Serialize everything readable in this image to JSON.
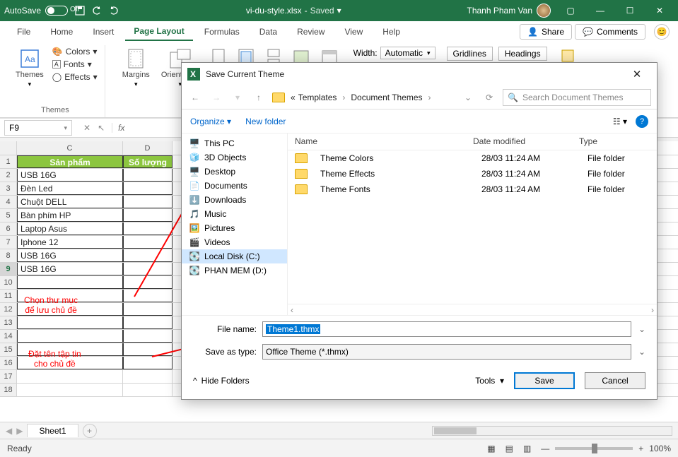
{
  "titlebar": {
    "autosave_label": "AutoSave",
    "toggle_off": "Off",
    "filename": "vi-du-style.xlsx",
    "saved": "Saved",
    "user": "Thanh Pham Van"
  },
  "tabs": [
    "File",
    "Home",
    "Insert",
    "Page Layout",
    "Formulas",
    "Data",
    "Review",
    "View",
    "Help"
  ],
  "active_tab": "Page Layout",
  "share": "Share",
  "comments": "Comments",
  "ribbon": {
    "themes_group": "Themes",
    "themes": "Themes",
    "colors": "Colors",
    "fonts": "Fonts",
    "effects": "Effects",
    "margins": "Margins",
    "orientation": "Orientation",
    "width": "Width:",
    "width_val": "Automatic",
    "gridlines": "Gridlines",
    "headings": "Headings"
  },
  "namebox": "F9",
  "columns": [
    "C",
    "D"
  ],
  "header_row": {
    "c": "Sản phẩm",
    "d": "Số lượng"
  },
  "rows": [
    "USB 16G",
    "Đèn Led",
    "Chuột DELL",
    "Bàn phím HP",
    "Laptop Asus",
    "Iphone 12",
    "USB 16G",
    "USB 16G"
  ],
  "annotations": {
    "a1_l1": "Chọn thư mục",
    "a1_l2": "để lưu chủ đề",
    "a2_l1": "Đặt tên tập tin",
    "a2_l2": "cho chủ đề"
  },
  "sheet_tab": "Sheet1",
  "status": {
    "ready": "Ready",
    "zoom": "100%"
  },
  "dialog": {
    "title": "Save Current Theme",
    "crumb1": "Templates",
    "crumb2": "Document Themes",
    "search_ph": "Search Document Themes",
    "organize": "Organize",
    "new_folder": "New folder",
    "tree": [
      "This PC",
      "3D Objects",
      "Desktop",
      "Documents",
      "Downloads",
      "Music",
      "Pictures",
      "Videos",
      "Local Disk (C:)",
      "PHAN MEM (D:)"
    ],
    "col_name": "Name",
    "col_date": "Date modified",
    "col_type": "Type",
    "files": [
      {
        "n": "Theme Colors",
        "d": "28/03 11:24 AM",
        "t": "File folder"
      },
      {
        "n": "Theme Effects",
        "d": "28/03 11:24 AM",
        "t": "File folder"
      },
      {
        "n": "Theme Fonts",
        "d": "28/03 11:24 AM",
        "t": "File folder"
      }
    ],
    "file_name_lbl": "File name:",
    "file_name_val": "Theme1.thmx",
    "save_type_lbl": "Save as type:",
    "save_type_val": "Office Theme (*.thmx)",
    "hide_folders": "Hide Folders",
    "tools": "Tools",
    "save": "Save",
    "cancel": "Cancel"
  }
}
